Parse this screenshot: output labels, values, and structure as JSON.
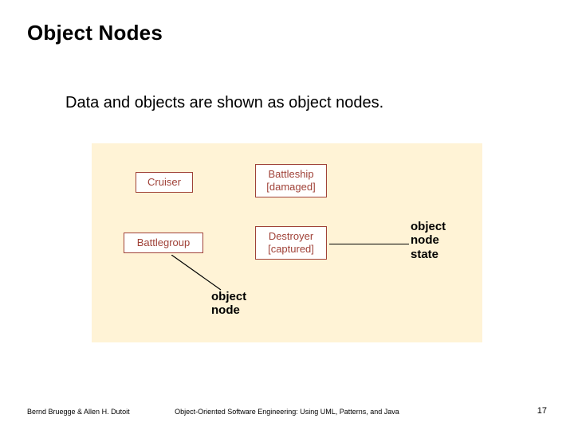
{
  "title": "Object Nodes",
  "subtitle": "Data and objects are shown as object nodes.",
  "boxes": {
    "cruiser": "Cruiser",
    "battleship_name": "Battleship",
    "battleship_state": "[damaged]",
    "battlegroup": "Battlegroup",
    "destroyer_name": "Destroyer",
    "destroyer_state": "[captured]"
  },
  "labels": {
    "object_node_state_l1": "object",
    "object_node_state_l2": "node",
    "object_node_state_l3": "state",
    "object_node_l1": "object",
    "object_node_l2": "node"
  },
  "footer": {
    "authors": "Bernd Bruegge & Allen H. Dutoit",
    "book": "Object-Oriented Software Engineering: Using UML, Patterns, and Java",
    "page": "17"
  }
}
